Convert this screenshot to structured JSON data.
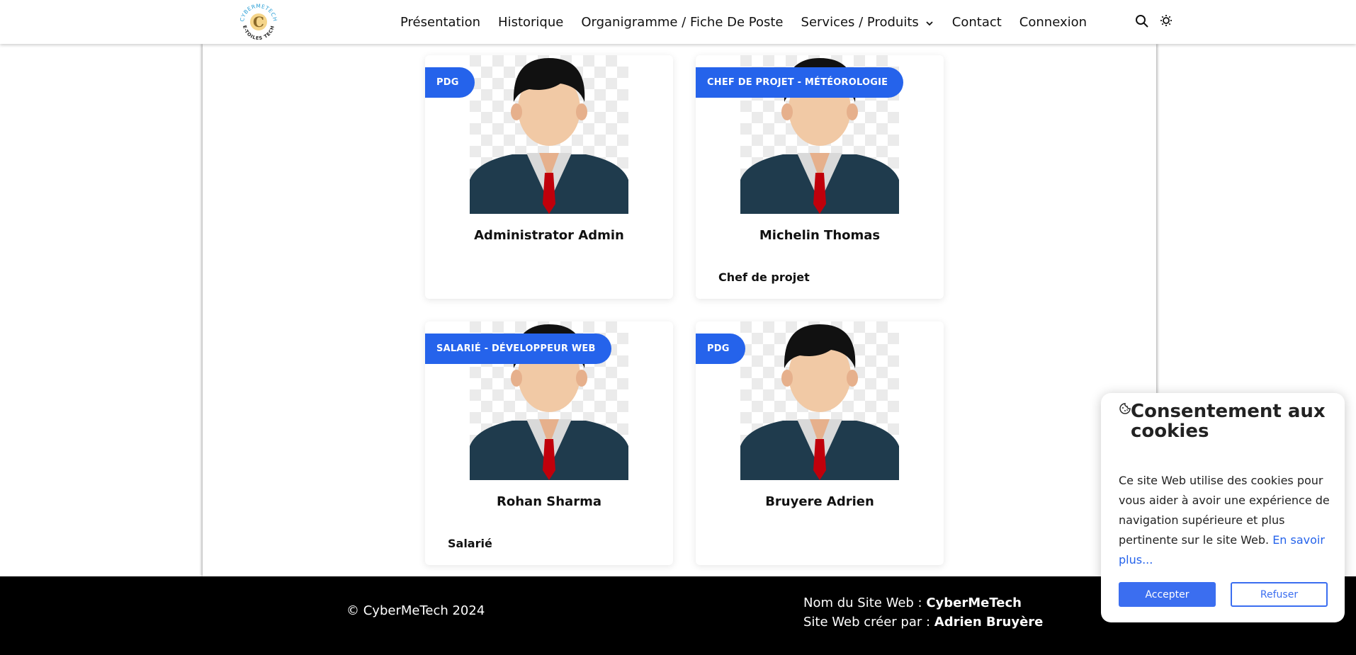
{
  "logo": {
    "text_top": "CYBERMETECH",
    "text_bottom": "E-TOILES TECH",
    "monogram": "C"
  },
  "nav": {
    "items": [
      {
        "label": "Présentation"
      },
      {
        "label": "Historique"
      },
      {
        "label": "Organigramme / Fiche De Poste"
      },
      {
        "label": "Services / Produits",
        "dropdown": true
      },
      {
        "label": "Contact"
      },
      {
        "label": "Connexion"
      }
    ],
    "search_icon": "search-icon",
    "theme_icon": "sun-icon"
  },
  "employees": [
    {
      "badge": "PDG",
      "name": "Administrator Admin",
      "role": ""
    },
    {
      "badge": "CHEF DE PROJET - MÉTÉOROLOGIE",
      "name": "Michelin Thomas",
      "role": "Chef de projet"
    },
    {
      "badge": "SALARIÉ - DÉVELOPPEUR WEB",
      "name": "Rohan Sharma",
      "role": "Salarié"
    },
    {
      "badge": "PDG",
      "name": "Bruyere Adrien",
      "role": ""
    }
  ],
  "footer": {
    "copyright": "© CyberMeTech 2024",
    "site_name_label": "Nom du Site Web : ",
    "site_name": "CyberMeTech",
    "author_label": "Site Web créer par : ",
    "author": "Adrien Bruyère"
  },
  "cookie": {
    "title": "Consentement aux cookies",
    "text": "Ce site Web utilise des cookies pour vous aider à avoir une expérience de navigation supérieure et plus pertinente sur le site Web. ",
    "link": "En savoir plus...",
    "accept": "Accepter",
    "refuse": "Refuser"
  },
  "colors": {
    "accent": "#2563eb",
    "footer_bg": "#000000",
    "suit": "#1f3b4d",
    "tie": "#c0000b",
    "skin": "#f1c9a5",
    "hair": "#111111"
  }
}
